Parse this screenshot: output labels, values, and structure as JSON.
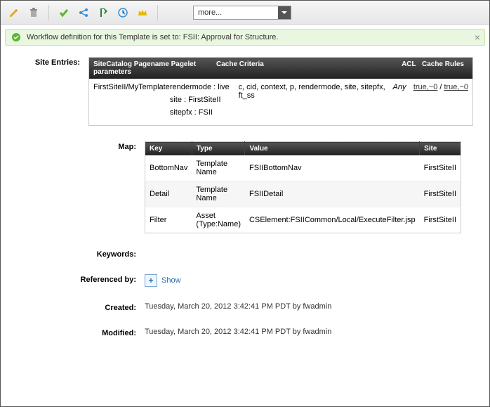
{
  "toolbar": {
    "more_label": "more..."
  },
  "notification": {
    "text": "Workflow definition for this Template is set to: FSII: Approval for Structure."
  },
  "labels": {
    "site_entries": "Site Entries:",
    "map": "Map:",
    "keywords": "Keywords:",
    "referenced_by": "Referenced by:",
    "created": "Created:",
    "modified": "Modified:",
    "show": "Show"
  },
  "site_entries": {
    "headers": {
      "pagename": "SiteCatalog Pagename",
      "pagelet_params": "Pagelet parameters",
      "cache_criteria": "Cache Criteria",
      "acl": "ACL",
      "cache_rules": "Cache Rules"
    },
    "row": {
      "pagename": "FirstSiteII/MyTemplate",
      "params": [
        "rendermode : live",
        "site : FirstSiteII",
        "sitepfx : FSII"
      ],
      "criteria": "c, cid, context, p, rendermode, site, sitepfx, ft_ss",
      "acl": "Any",
      "rule_a": "true,~0",
      "rule_b": "true,~0"
    }
  },
  "map": {
    "headers": {
      "key": "Key",
      "type": "Type",
      "value": "Value",
      "site": "Site"
    },
    "rows": [
      {
        "key": "BottomNav",
        "type": "Template Name",
        "value": "FSIIBottomNav",
        "site": "FirstSiteII"
      },
      {
        "key": "Detail",
        "type": "Template Name",
        "value": "FSIIDetail",
        "site": "FirstSiteII"
      },
      {
        "key": "Filter",
        "type": "Asset (Type:Name)",
        "value": "CSElement:FSIICommon/Local/ExecuteFilter.jsp",
        "site": "FirstSiteII"
      }
    ]
  },
  "meta": {
    "created": "Tuesday, March 20, 2012 3:42:41 PM PDT by fwadmin",
    "modified": "Tuesday, March 20, 2012 3:42:41 PM PDT by fwadmin"
  }
}
